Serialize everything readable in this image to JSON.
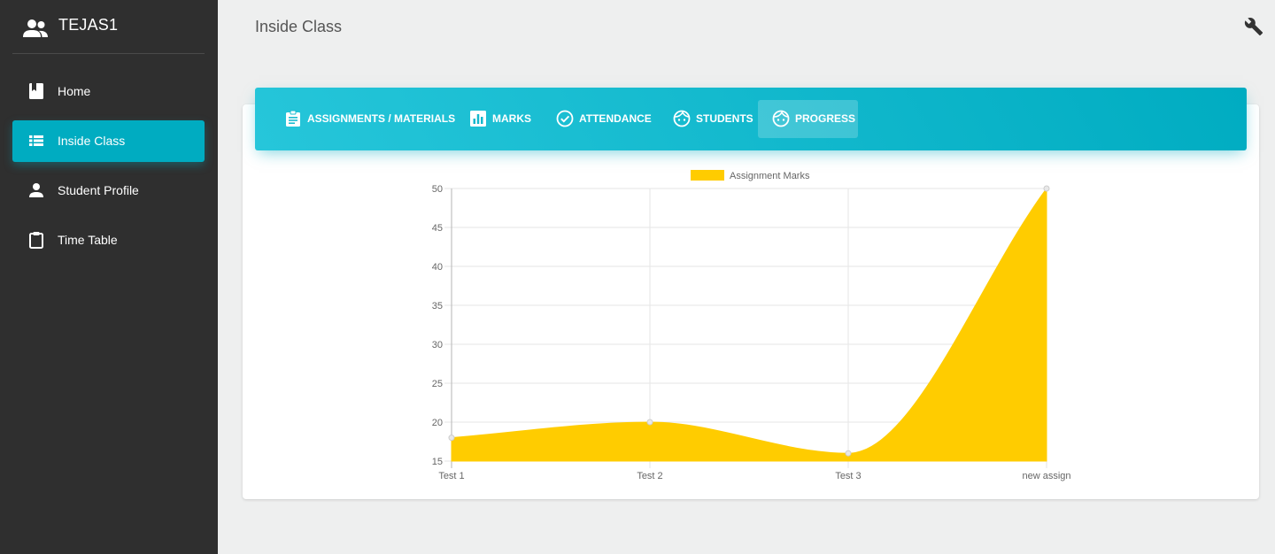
{
  "sidebar": {
    "brand": {
      "name": "TEJAS1",
      "icon": "people-icon"
    },
    "items": [
      {
        "label": "Home",
        "icon": "book-icon",
        "active": false
      },
      {
        "label": "Inside Class",
        "icon": "list-icon",
        "active": true
      },
      {
        "label": "Student Profile",
        "icon": "person-icon",
        "active": false
      },
      {
        "label": "Time Table",
        "icon": "clipboard-icon",
        "active": false
      }
    ]
  },
  "header": {
    "title": "Inside Class",
    "settings_icon": "wrench-icon"
  },
  "tabs": [
    {
      "label": "ASSIGNMENTS / MATERIALS",
      "icon": "assignment-icon",
      "active": false
    },
    {
      "label": "MARKS",
      "icon": "bar-chart-icon",
      "active": false
    },
    {
      "label": "ATTENDANCE",
      "icon": "check-circle-icon",
      "active": false
    },
    {
      "label": "STUDENTS",
      "icon": "face-icon",
      "active": false
    },
    {
      "label": "PROGRESS",
      "icon": "face-icon",
      "active": true
    }
  ],
  "colors": {
    "accent": "#00acc1",
    "sidebar": "#2f2f2f",
    "series": "#ffcc00"
  },
  "chart_data": {
    "type": "area",
    "categories": [
      "Test 1",
      "Test 2",
      "Test 3",
      "new assign"
    ],
    "series": [
      {
        "name": "Assignment Marks",
        "values": [
          18,
          20,
          16,
          50
        ]
      }
    ],
    "yticks": [
      15,
      20,
      25,
      30,
      35,
      40,
      45,
      50
    ],
    "ylim": [
      15,
      50
    ],
    "grid": true,
    "legend": "top-center"
  }
}
